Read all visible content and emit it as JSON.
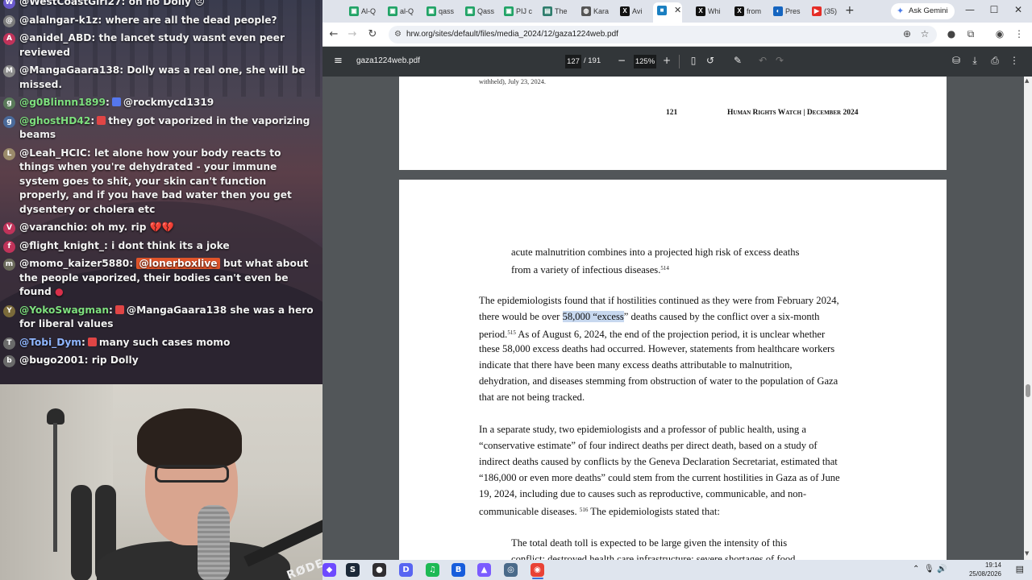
{
  "chat": {
    "messages": [
      {
        "user": "@WestCoastGirl27",
        "text": "on no Dolly",
        "user_color": "#f5f5f5",
        "avatar_letter": "W",
        "avatar_color": "#6a5acd"
      },
      {
        "user": "@alalngar-k1z",
        "text": "where are all the dead people?",
        "user_color": "#f5f5f5",
        "avatar_letter": "@",
        "avatar_color": "#7c7c7c"
      },
      {
        "user": "@anidel_ABD",
        "text": "the lancet study wasnt even peer reviewed",
        "user_color": "#f5f5f5",
        "avatar_letter": "A",
        "avatar_color": "#c0335a"
      },
      {
        "user": "@MangaGaara138",
        "text": "Dolly was a real one, she will be missed.",
        "user_color": "#f5f5f5",
        "avatar_letter": "M",
        "avatar_color": "#8a8a8a"
      },
      {
        "user": "@g0Blinnn1899",
        "text": "@rockmycd1319",
        "user_color": "#7ee07e",
        "avatar_letter": "g",
        "avatar_color": "#5a7a5a",
        "badge": "#5577ee"
      },
      {
        "user": "@ghostHD42",
        "text": "they got vaporized in the vaporizing beams",
        "user_color": "#7ee07e",
        "avatar_letter": "g",
        "avatar_color": "#4a6a9a",
        "badge": "#e04545"
      },
      {
        "user": "@Leah_HCIC",
        "text": "let alone how your body reacts to things when you're dehydrated - your immune system goes to shit, your skin can't function properly, and if you have bad water then you get dysentery or cholera etc",
        "user_color": "#f5f5f5",
        "avatar_letter": "L",
        "avatar_color": "#9a8a6a"
      },
      {
        "user": "@varanchio",
        "text": "oh my. rip",
        "hearts": "💔💔",
        "user_color": "#f5f5f5",
        "avatar_letter": "V",
        "avatar_color": "#c0335a"
      },
      {
        "user": "@flight_knight_",
        "text": "i dont think its a joke",
        "user_color": "#f5f5f5",
        "avatar_letter": "f",
        "avatar_color": "#c0335a"
      },
      {
        "user": "@momo_kaizer5880",
        "mention": "@lonerboxlive",
        "text": "but what about the people vaporized, their bodies can't even be found",
        "user_color": "#f5f5f5",
        "avatar_letter": "m",
        "avatar_color": "#6a6a5a"
      },
      {
        "user": "@YokoSwagman",
        "text": "@MangaGaara138 she was a hero for liberal values",
        "user_color": "#7ee07e",
        "avatar_letter": "Y",
        "avatar_color": "#7a6a3a",
        "badge": "#e04545"
      },
      {
        "user": "@Tobi_Dym",
        "text": "many such cases momo",
        "user_color": "#8fb6ff",
        "avatar_letter": "T",
        "avatar_color": "#6a6a6a",
        "badge": "#e04545"
      },
      {
        "user": "@bugo2001",
        "text": "rip Dolly",
        "user_color": "#f5f5f5",
        "avatar_letter": "b",
        "avatar_color": "#6a6a6a"
      }
    ]
  },
  "webcam": {
    "mic_brand": "RØDE"
  },
  "browser": {
    "tabs": [
      {
        "label": "Al-Q",
        "fav_color": "#21a366"
      },
      {
        "label": "al-Q",
        "fav_color": "#21a366"
      },
      {
        "label": "qass",
        "fav_color": "#21a366"
      },
      {
        "label": "Qass",
        "fav_color": "#21a366"
      },
      {
        "label": "PIJ c",
        "fav_color": "#21a366"
      },
      {
        "label": "The",
        "fav_color": "#2f7d6d"
      },
      {
        "label": "Kara",
        "fav_color": "#555555"
      },
      {
        "label": "Avi",
        "fav_color": "#111111"
      },
      {
        "label": "",
        "fav_color": "#1a7fc1"
      },
      {
        "label": "Whi",
        "fav_color": "#111111"
      },
      {
        "label": "from",
        "fav_color": "#111111"
      },
      {
        "label": "Pres",
        "fav_color": "#1565c0"
      },
      {
        "label": "(35)",
        "fav_color": "#e52d27"
      }
    ],
    "gemini_label": "Ask Gemini",
    "url": "hrw.org/sites/default/files/media_2024/12/gaza1224web.pdf"
  },
  "pdf": {
    "filename": "gaza1224web.pdf",
    "current_page": "127",
    "total_pages": "/ 191",
    "zoom": "125%",
    "prev_page": {
      "footnote_tail": "withheld), July 23, 2024.",
      "page_number": "121",
      "running_title": "Human Rights Watch | December 2024"
    },
    "page": {
      "quote1_lines": [
        "acute malnutrition combines into a projected high risk of excess deaths",
        "from a variety of infectious diseases."
      ],
      "quote1_fn": "514",
      "p1_line1": "The epidemiologists found that if hostilities continued as they were from February 2024,",
      "p1_line2_pre": "there would be over ",
      "p1_line2_hl": "58,000 “excess",
      "p1_line2_post": "” deaths caused by the conflict over a six-month",
      "p1_line3_pre": "period.",
      "p1_fn": "515",
      "p1_line3_post": " As of August 6, 2024, the end of the projection period, it is unclear whether",
      "p1_rest": [
        "these 58,000 excess deaths had occurred. However, statements from healthcare workers",
        "indicate that there have been many excess deaths attributable to malnutrition,",
        "dehydration, and diseases stemming from obstruction of water to the population of Gaza",
        "that are not being tracked."
      ],
      "p2_lines": [
        "In a separate study, two epidemiologists and a professor of public health, using a",
        "“conservative estimate” of four indirect deaths per direct death, based on a study of",
        "indirect deaths caused by conflicts by the Geneva Declaration Secretariat, estimated that",
        "“186,000 or even more deaths” could stem from the current hostilities in Gaza as of June",
        "19, 2024, including due to causes such as reproductive, communicable, and non-"
      ],
      "p2_last_pre": "communicable diseases.",
      "p2_fn": "516",
      "p2_last_post": " The epidemiologists stated that:",
      "quote2_lines": [
        "The total death toll is expected to be large given the intensity of this",
        "conflict; destroyed health care infrastructure; severe shortages of food,"
      ]
    }
  },
  "taskbar": {
    "time": "19:14",
    "date": "25/08/2026",
    "icons": [
      {
        "name": "proton-icon",
        "color": "#6d4aff",
        "glyph": "◆"
      },
      {
        "name": "steam-icon",
        "color": "#1b2838",
        "glyph": "S"
      },
      {
        "name": "obs-icon",
        "color": "#302e31",
        "glyph": "●"
      },
      {
        "name": "discord-icon",
        "color": "#5865f2",
        "glyph": "D"
      },
      {
        "name": "spotify-icon",
        "color": "#1db954",
        "glyph": "♫"
      },
      {
        "name": "bitwarden-icon",
        "color": "#175ddc",
        "glyph": "B"
      },
      {
        "name": "app-icon",
        "color": "#7b5cff",
        "glyph": "▲"
      },
      {
        "name": "app2-icon",
        "color": "#4a6a8a",
        "glyph": "◎"
      },
      {
        "name": "chrome-icon",
        "color": "#e94235",
        "glyph": "◉"
      }
    ]
  }
}
